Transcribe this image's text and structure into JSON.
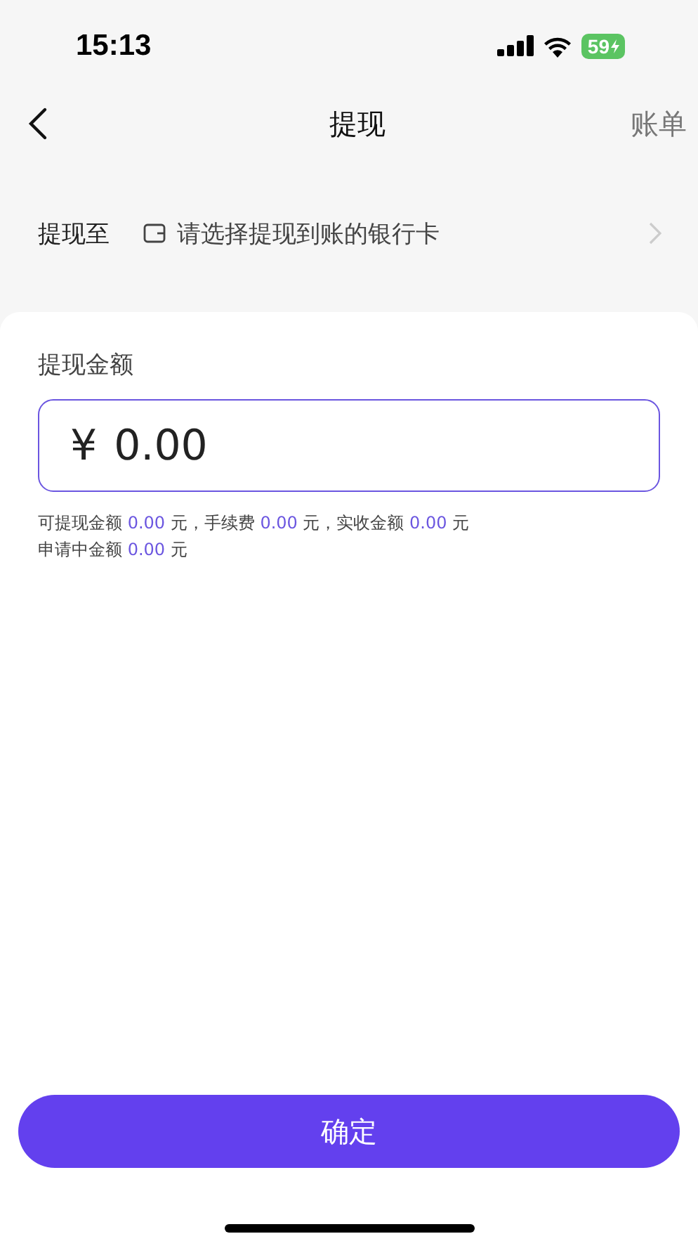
{
  "status_bar": {
    "time": "15:13",
    "battery": "59"
  },
  "nav": {
    "title": "提现",
    "action": "账单"
  },
  "withdraw_to": {
    "label": "提现至",
    "placeholder": "请选择提现到账的银行卡"
  },
  "amount": {
    "label": "提现金额",
    "currency": "¥",
    "value": "0.00"
  },
  "info_lines": [
    [
      {
        "kind": "text",
        "text": "可提现金额 "
      },
      {
        "kind": "amount",
        "text": "0.00"
      },
      {
        "kind": "text",
        "text": " 元，手续费 "
      },
      {
        "kind": "amount",
        "text": "0.00"
      },
      {
        "kind": "text",
        "text": " 元，实收金额 "
      },
      {
        "kind": "amount",
        "text": "0.00"
      },
      {
        "kind": "text",
        "text": " 元"
      }
    ],
    [
      {
        "kind": "text",
        "text": "申请中金额 "
      },
      {
        "kind": "amount",
        "text": "0.00"
      },
      {
        "kind": "text",
        "text": " 元"
      }
    ]
  ],
  "confirm_button": "确定"
}
